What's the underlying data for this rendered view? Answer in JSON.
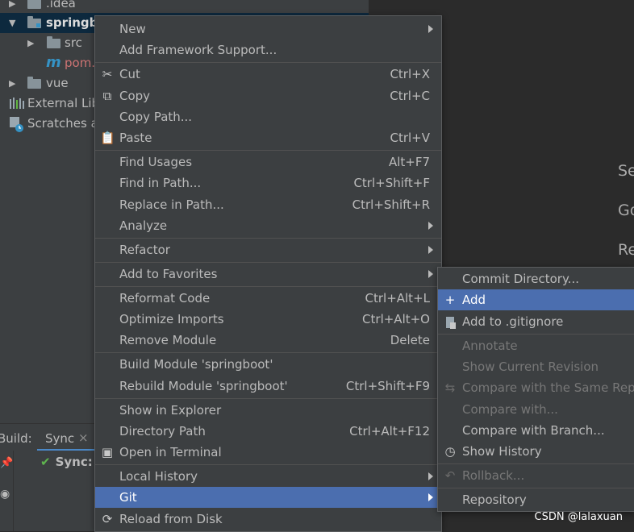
{
  "project_tree": {
    "rows": [
      {
        "label": ".idea"
      },
      {
        "label": "springbo"
      },
      {
        "label": "src"
      },
      {
        "label": "pom."
      },
      {
        "label": "vue"
      },
      {
        "label": "External Lib"
      },
      {
        "label": "Scratches a"
      }
    ]
  },
  "editor_hints": [
    "Se",
    "Go",
    "Re"
  ],
  "build_bar": {
    "label": "Build:",
    "tab": "Sync",
    "tab_close": "×",
    "sync_status": "Sync:"
  },
  "context_menu": {
    "items": [
      {
        "label": "New",
        "shortcut": ""
      },
      {
        "label": "Add Framework Support...",
        "shortcut": ""
      },
      {
        "label": "Cut",
        "shortcut": "Ctrl+X"
      },
      {
        "label": "Copy",
        "shortcut": "Ctrl+C"
      },
      {
        "label": "Copy Path...",
        "shortcut": ""
      },
      {
        "label": "Paste",
        "shortcut": "Ctrl+V"
      },
      {
        "label": "Find Usages",
        "shortcut": "Alt+F7"
      },
      {
        "label": "Find in Path...",
        "shortcut": "Ctrl+Shift+F"
      },
      {
        "label": "Replace in Path...",
        "shortcut": "Ctrl+Shift+R"
      },
      {
        "label": "Analyze",
        "shortcut": ""
      },
      {
        "label": "Refactor",
        "shortcut": ""
      },
      {
        "label": "Add to Favorites",
        "shortcut": ""
      },
      {
        "label": "Reformat Code",
        "shortcut": "Ctrl+Alt+L"
      },
      {
        "label": "Optimize Imports",
        "shortcut": "Ctrl+Alt+O"
      },
      {
        "label": "Remove Module",
        "shortcut": "Delete"
      },
      {
        "label": "Build Module 'springboot'",
        "shortcut": ""
      },
      {
        "label": "Rebuild Module 'springboot'",
        "shortcut": "Ctrl+Shift+F9"
      },
      {
        "label": "Show in Explorer",
        "shortcut": ""
      },
      {
        "label": "Directory Path",
        "shortcut": "Ctrl+Alt+F12"
      },
      {
        "label": "Open in Terminal",
        "shortcut": ""
      },
      {
        "label": "Local History",
        "shortcut": ""
      },
      {
        "label": "Git",
        "shortcut": ""
      },
      {
        "label": "Reload from Disk",
        "shortcut": ""
      }
    ]
  },
  "git_submenu": {
    "items": [
      {
        "label": "Commit Directory..."
      },
      {
        "label": "Add"
      },
      {
        "label": "Add to .gitignore"
      },
      {
        "label": "Annotate"
      },
      {
        "label": "Show Current Revision"
      },
      {
        "label": "Compare with the Same Repo"
      },
      {
        "label": "Compare with..."
      },
      {
        "label": "Compare with Branch..."
      },
      {
        "label": "Show History"
      },
      {
        "label": "Rollback..."
      },
      {
        "label": "Repository"
      }
    ]
  },
  "watermark": "CSDN @lalaxuan",
  "colors": {
    "menu_bg": "#3c3f41",
    "highlight": "#4b6eaf",
    "editor_bg": "#2b2b2b",
    "selected_row": "#0d293e"
  }
}
